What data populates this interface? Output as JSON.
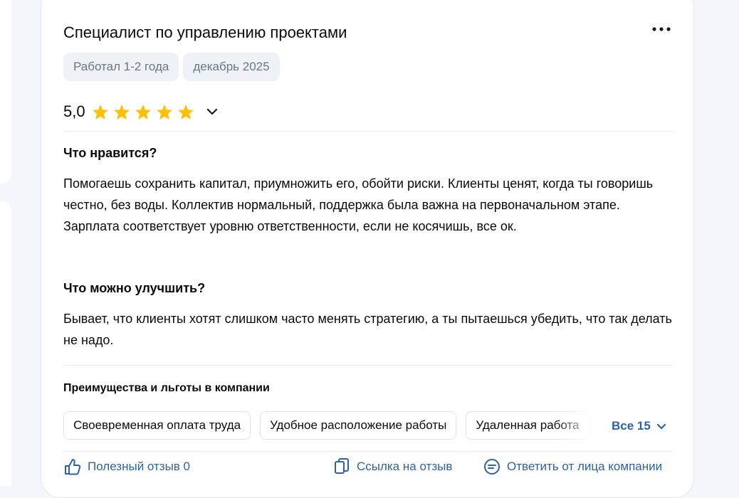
{
  "review": {
    "title": "Специалист по управлению проектами",
    "tags": [
      "Работал 1-2 года",
      "декабрь 2025"
    ],
    "rating": {
      "value_text": "5,0",
      "stars": 5,
      "max_stars": 5
    },
    "likes": {
      "heading": "Что нравится?",
      "text": "Помогаешь сохранить капитал, приумножить его, обойти риски. Клиенты ценят, когда ты говоришь честно, без воды. Коллектив нормальный, поддержка была важна на первоначальном этапе. Зарплата соответствует уровню ответственности, если не косячишь, все ок."
    },
    "improve": {
      "heading": "Что можно улучшить?",
      "text": "Бывает, что клиенты хотят слишком часто менять стратегию, а ты пытаешься убедить, что так делать не надо."
    },
    "benefits": {
      "heading": "Преимущества и льготы в компании",
      "items": [
        "Своевременная оплата труда",
        "Удобное расположение работы",
        "Удаленная работа"
      ],
      "all_label": "Все 15"
    },
    "footer": {
      "useful_label": "Полезный отзыв 0",
      "link_label": "Ссылка на отзыв",
      "reply_label": "Ответить от лица компании"
    }
  },
  "colors": {
    "accent": "#2d62a8",
    "star": "#ffc107",
    "tag_bg": "#eef1f6",
    "tag_text": "#6b7687",
    "page_bg": "#f4f6fb"
  },
  "icons": [
    "more-horizontal-icon",
    "star-icon",
    "chevron-down-icon",
    "thumbs-up-icon",
    "link-icon",
    "reply-icon"
  ]
}
